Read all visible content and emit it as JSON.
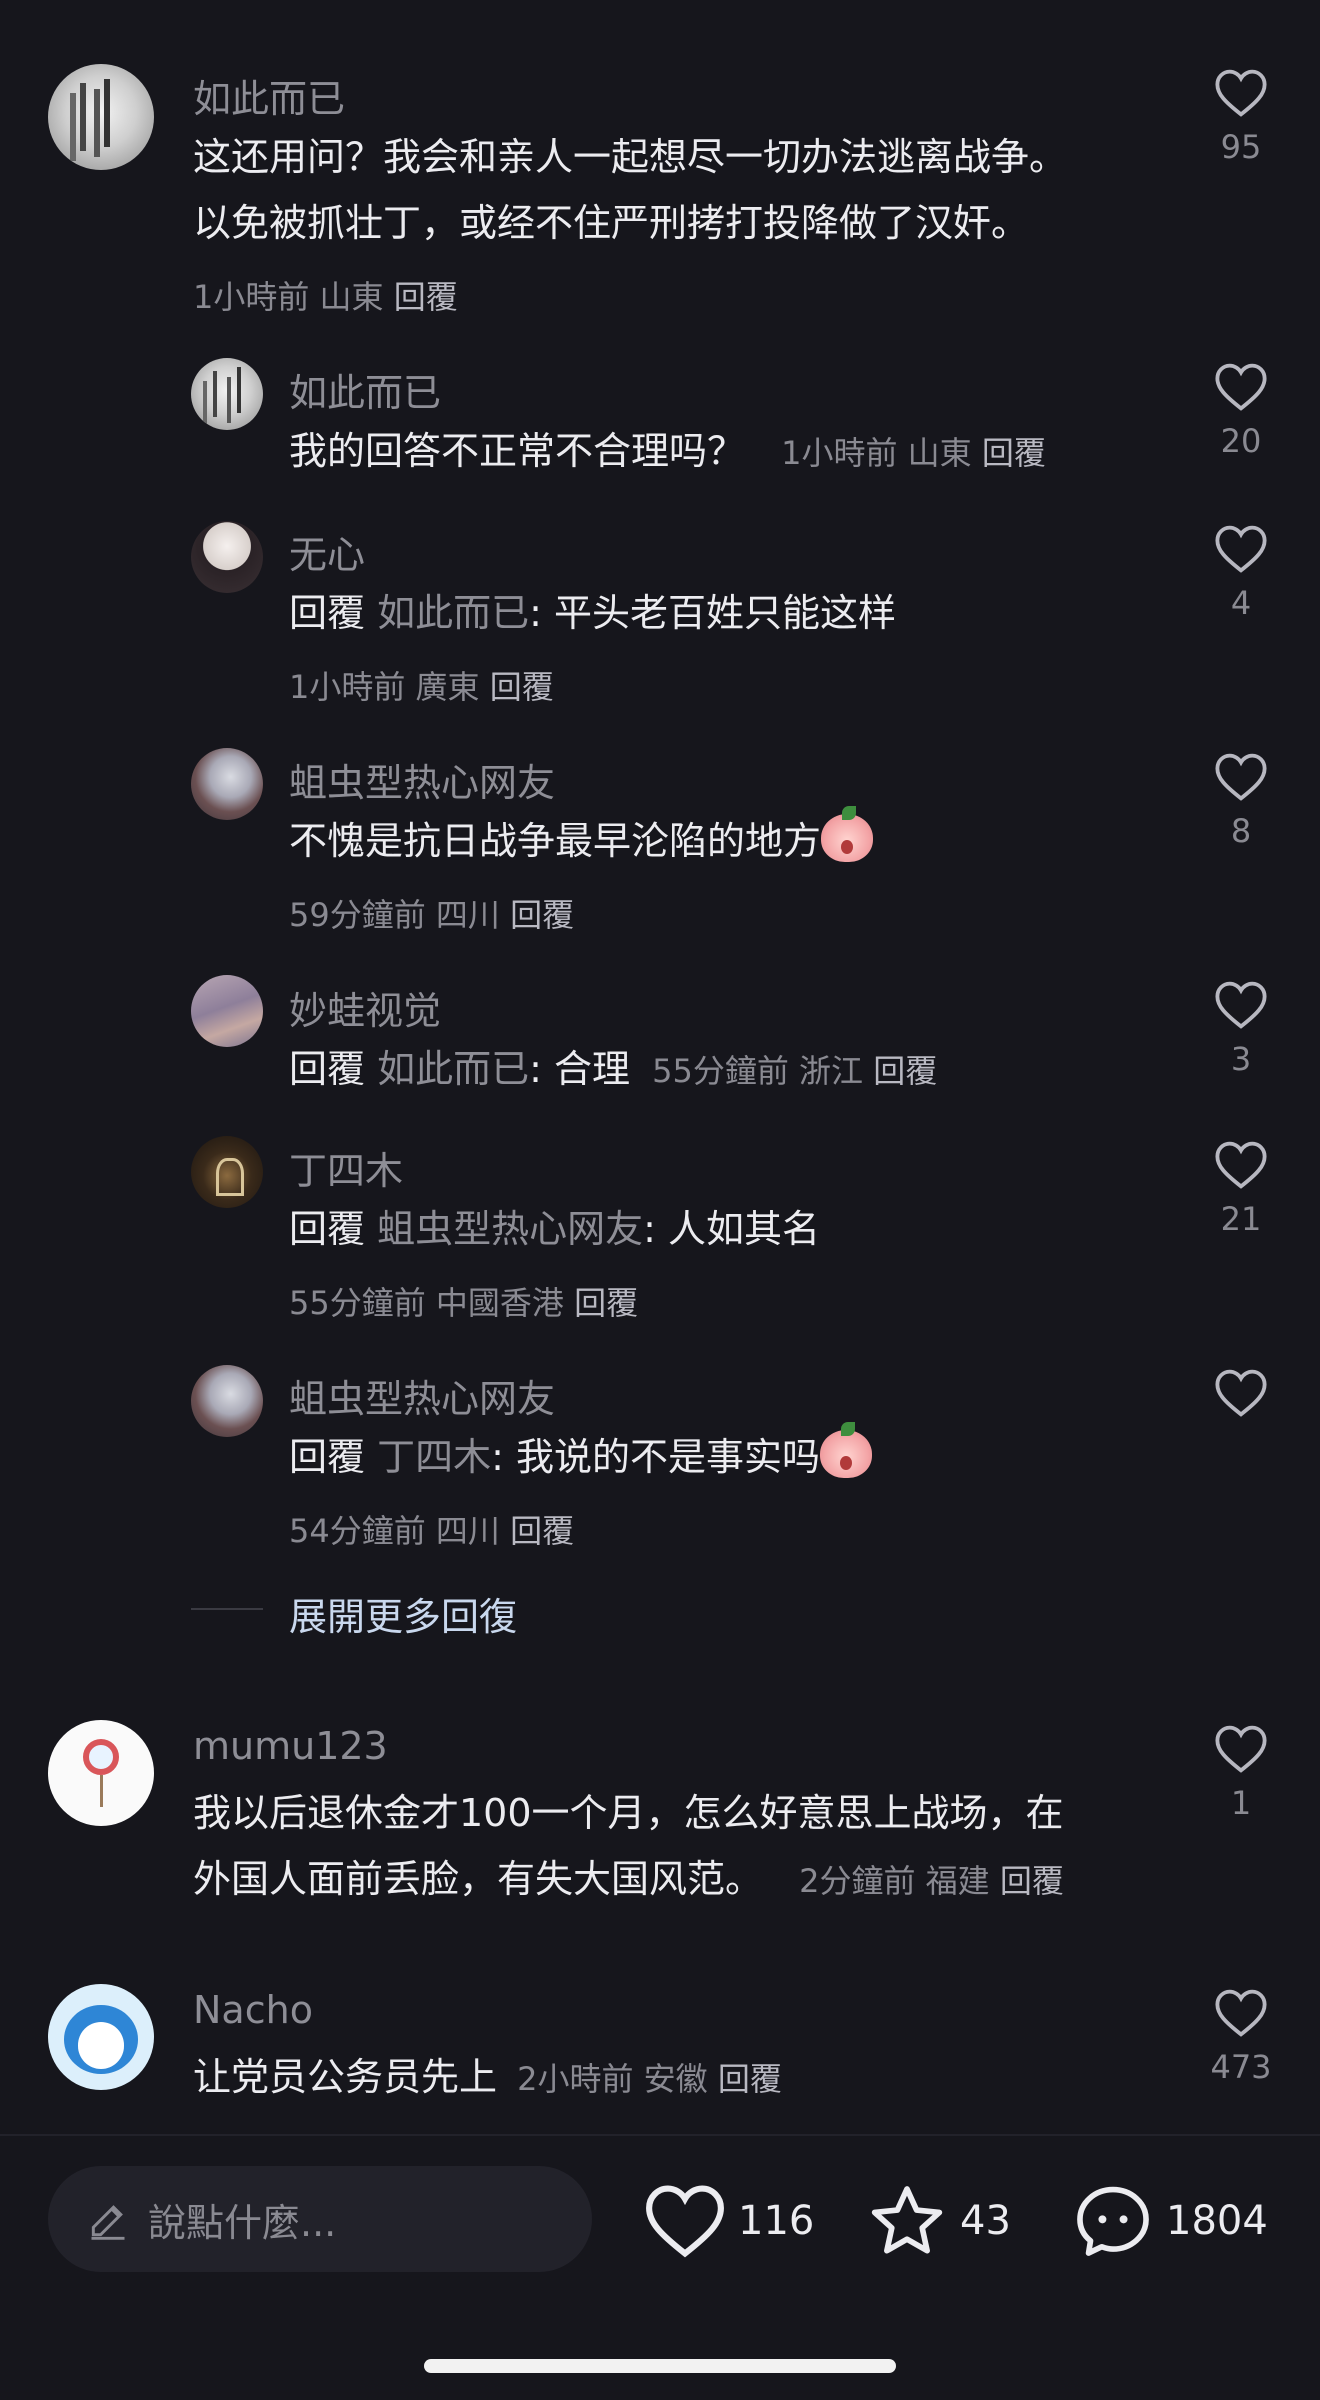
{
  "comments": [
    {
      "name": "如此而已",
      "body_line1": "这还用问？我会和亲人一起想尽一切办法逃离战争。",
      "body_line2": "以免被抓壮丁，或经不住严刑拷打投降做了汉奸。",
      "time": "1小時前",
      "location": "山東",
      "reply_label": "回覆",
      "likes": "95"
    },
    {
      "name": "如此而已",
      "body": "我的回答不正常不合理吗？",
      "time": "1小時前",
      "location": "山東",
      "reply_label": "回覆",
      "likes": "20"
    },
    {
      "name": "无心",
      "reply_prefix": "回覆",
      "reply_target": "如此而已",
      "body": ": 平头老百姓只能这样",
      "time": "1小時前",
      "location": "廣東",
      "reply_label": "回覆",
      "likes": "4"
    },
    {
      "name": "蛆虫型热心网友",
      "body": "不愧是抗日战争最早沦陷的地方",
      "time": "59分鐘前",
      "location": "四川",
      "reply_label": "回覆",
      "likes": "8"
    },
    {
      "name": "妙蛙视觉",
      "reply_prefix": "回覆",
      "reply_target": "如此而已",
      "body": ": 合理",
      "time": "55分鐘前",
      "location": "浙江",
      "reply_label": "回覆",
      "likes": "3"
    },
    {
      "name": "丁四木",
      "reply_prefix": "回覆",
      "reply_target": "蛆虫型热心网友",
      "body": ": 人如其名",
      "time": "55分鐘前",
      "location": "中國香港",
      "reply_label": "回覆",
      "likes": "21"
    },
    {
      "name": "蛆虫型热心网友",
      "reply_prefix": "回覆",
      "reply_target": "丁四木",
      "body": ": 我说的不是事实吗",
      "time": "54分鐘前",
      "location": "四川",
      "reply_label": "回覆",
      "likes": ""
    },
    {
      "name": "mumu123",
      "body_line1": "我以后退休金才100一个月，怎么好意思上战场，在",
      "body_line2": "外国人面前丢脸，有失大国风范。",
      "time": "2分鐘前",
      "location": "福建",
      "reply_label": "回覆",
      "likes": "1"
    },
    {
      "name": "Nacho",
      "body": "让党员公务员先上",
      "time": "2小時前",
      "location": "安徽",
      "reply_label": "回覆",
      "likes": "473"
    }
  ],
  "expand_more": "展開更多回復",
  "bottom_bar": {
    "input_placeholder": "說點什麼...",
    "like_count": "116",
    "star_count": "43",
    "comment_count": "1804"
  },
  "icons": {
    "like": "heart-outline-icon",
    "star": "star-outline-icon",
    "comment": "chat-bubble-icon",
    "pencil": "pencil-icon"
  }
}
